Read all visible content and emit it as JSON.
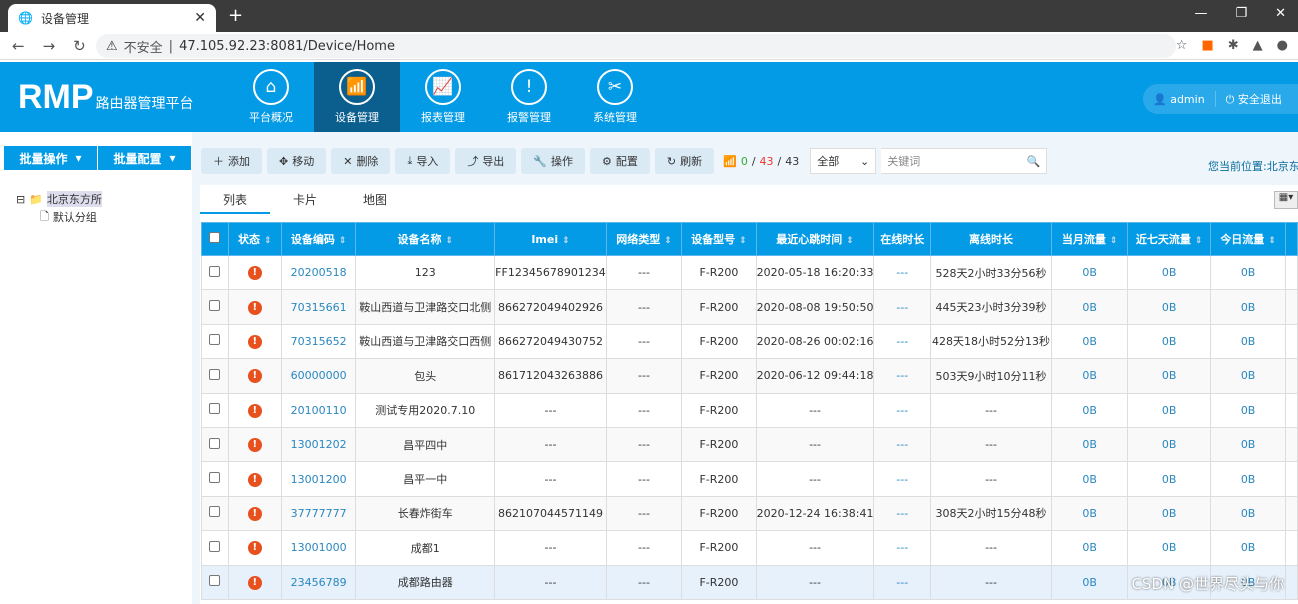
{
  "browser": {
    "tab_title": "设备管理",
    "security": "不安全",
    "url": "47.105.92.23:8081/Device/Home"
  },
  "header": {
    "logo": "RMP",
    "subtitle": "路由器管理平台",
    "menu": [
      {
        "label": "平台概况",
        "icon": "home-icon"
      },
      {
        "label": "设备管理",
        "icon": "router-icon",
        "active": true
      },
      {
        "label": "报表管理",
        "icon": "chart-icon"
      },
      {
        "label": "报警管理",
        "icon": "warning-icon"
      },
      {
        "label": "系统管理",
        "icon": "tools-icon"
      }
    ],
    "user": "admin",
    "logout": "安全退出"
  },
  "sidebar": {
    "batch_ops": "批量操作",
    "batch_config": "批量配置",
    "tree": {
      "root": "北京东方所",
      "child": "默认分组"
    }
  },
  "toolbar": {
    "buttons": [
      "添加",
      "移动",
      "删除",
      "导入",
      "导出",
      "操作",
      "配置",
      "刷新"
    ],
    "online": "0",
    "offline": "43",
    "total": "43",
    "filter": "全部",
    "keyword_placeholder": "关键词",
    "location": "您当前位置:北京东方所"
  },
  "views": [
    "列表",
    "卡片",
    "地图"
  ],
  "table": {
    "headers": [
      "状态",
      "设备编码",
      "设备名称",
      "Imei",
      "网络类型",
      "设备型号",
      "最近心跳时间",
      "在线时长",
      "离线时长",
      "当月流量",
      "近七天流量",
      "今日流量"
    ],
    "rows": [
      [
        "20200518",
        "123",
        "FF12345678901234",
        "---",
        "F-R200",
        "2020-05-18 16:20:33",
        "---",
        "528天2小时33分56秒",
        "0B",
        "0B",
        "0B"
      ],
      [
        "70315661",
        "鞍山西道与卫津路交口北侧",
        "866272049402926",
        "---",
        "F-R200",
        "2020-08-08 19:50:50",
        "---",
        "445天23小时3分39秒",
        "0B",
        "0B",
        "0B"
      ],
      [
        "70315652",
        "鞍山西道与卫津路交口西侧",
        "866272049430752",
        "---",
        "F-R200",
        "2020-08-26 00:02:16",
        "---",
        "428天18小时52分13秒",
        "0B",
        "0B",
        "0B"
      ],
      [
        "60000000",
        "包头",
        "861712043263886",
        "---",
        "F-R200",
        "2020-06-12 09:44:18",
        "---",
        "503天9小时10分11秒",
        "0B",
        "0B",
        "0B"
      ],
      [
        "20100110",
        "测试专用2020.7.10",
        "---",
        "---",
        "F-R200",
        "---",
        "---",
        "---",
        "0B",
        "0B",
        "0B"
      ],
      [
        "13001202",
        "昌平四中",
        "---",
        "---",
        "F-R200",
        "---",
        "---",
        "---",
        "0B",
        "0B",
        "0B"
      ],
      [
        "13001200",
        "昌平一中",
        "---",
        "---",
        "F-R200",
        "---",
        "---",
        "---",
        "0B",
        "0B",
        "0B"
      ],
      [
        "37777777",
        "长春炸街车",
        "862107044571149",
        "---",
        "F-R200",
        "2020-12-24 16:38:41",
        "---",
        "308天2小时15分48秒",
        "0B",
        "0B",
        "0B"
      ],
      [
        "13001000",
        "成都1",
        "---",
        "---",
        "F-R200",
        "---",
        "---",
        "---",
        "0B",
        "0B",
        "0B"
      ],
      [
        "23456789",
        "成都路由器",
        "---",
        "---",
        "F-R200",
        "---",
        "---",
        "---",
        "0B",
        "0B",
        "0B"
      ]
    ]
  },
  "watermark": "CSDN @世界尽头与你"
}
